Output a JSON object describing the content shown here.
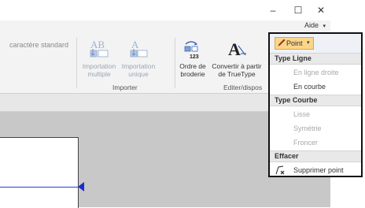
{
  "window": {
    "minimize": "–",
    "maximize": "☐",
    "close": "✕"
  },
  "help": {
    "label": "Aide",
    "chevron": "▾"
  },
  "ribbon": {
    "partial_label": "caractère standard",
    "buttons": [
      {
        "label1": "Importation",
        "label2": "multiple",
        "icon": "ab-import-icon",
        "disabled": true
      },
      {
        "label1": "Importation",
        "label2": "unique",
        "icon": "a-import-icon",
        "disabled": true
      },
      {
        "label1": "Ordre de",
        "label2": "broderie",
        "icon": "embroidery-order-icon",
        "disabled": false
      },
      {
        "label1": "Convertir à partir",
        "label2": "de TrueType",
        "icon": "truetype-convert-icon",
        "disabled": false
      }
    ],
    "groups": [
      {
        "label": "Importer"
      },
      {
        "label": "Editer/dispos"
      }
    ]
  },
  "context_menu": {
    "button_label": "Point",
    "button_chevron": "▾",
    "sections": [
      {
        "title": "Type Ligne",
        "items": [
          {
            "label": "En ligne droite",
            "disabled": true
          },
          {
            "label": "En courbe",
            "disabled": false
          }
        ]
      },
      {
        "title": "Type Courbe",
        "items": [
          {
            "label": "Lisse",
            "disabled": true
          },
          {
            "label": "Symétrie",
            "disabled": true
          },
          {
            "label": "Froncer",
            "disabled": true
          }
        ]
      },
      {
        "title": "Effacer",
        "items": [
          {
            "label": "Supprimer point",
            "disabled": false,
            "icon": "delete-point-icon"
          }
        ]
      }
    ]
  },
  "colors": {
    "accent": "#fbd58a",
    "line": "#2a3fd6",
    "canvas": "#c8c8c8"
  }
}
